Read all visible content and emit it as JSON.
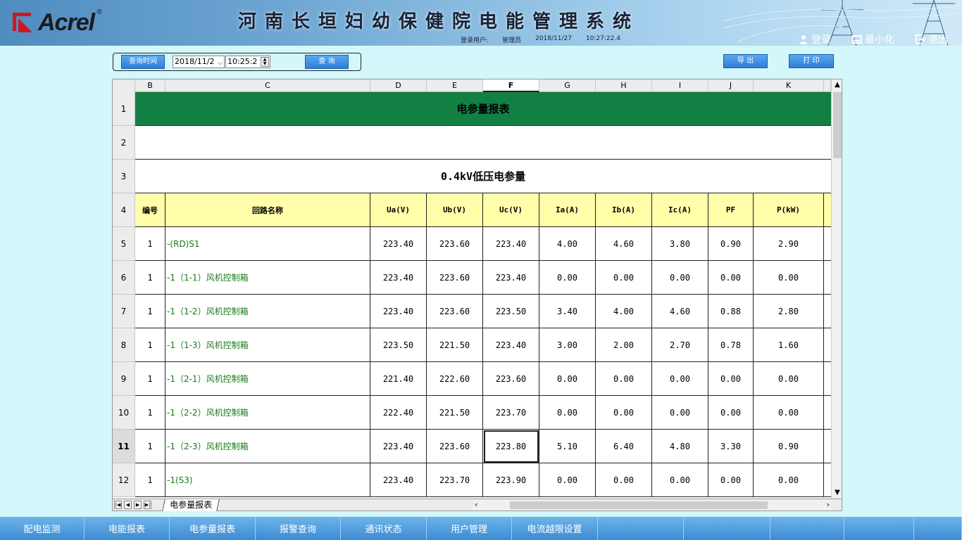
{
  "header": {
    "logo_text": "Acrel",
    "logo_reg": "®",
    "title": "河南长垣妇幼保健院电能管理系统",
    "login_label": "登录用户:",
    "login_user": "管理员",
    "login_date": "2018/11/27",
    "login_time": "10:27:22.4",
    "actions": {
      "login": "登录",
      "minimize": "最小化",
      "logout": "退出"
    }
  },
  "query": {
    "time_label": "查询时间",
    "date_value": "2018/11/2",
    "time_value": "10:25:2",
    "query_btn": "查 询",
    "export_btn": "导 出",
    "print_btn": "打 印"
  },
  "sheet": {
    "columns": [
      "B",
      "C",
      "D",
      "E",
      "F",
      "G",
      "H",
      "I",
      "J",
      "K"
    ],
    "active_column": "F",
    "row_numbers": [
      "1",
      "2",
      "3",
      "4",
      "5",
      "6",
      "7",
      "8",
      "9",
      "10",
      "11",
      "12"
    ],
    "active_row": "11",
    "title": "电参量报表",
    "section": "0.4kV低压电参量",
    "headers": [
      "编号",
      "回路名称",
      "Ua(V)",
      "Ub(V)",
      "Uc(V)",
      "Ia(A)",
      "Ib(A)",
      "Ic(A)",
      "PF",
      "P(kW)"
    ],
    "rows": [
      [
        "1",
        "-(RD)S1",
        "223.40",
        "223.60",
        "223.40",
        "4.00",
        "4.60",
        "3.80",
        "0.90",
        "2.90"
      ],
      [
        "1",
        "-1（1-1）风机控制箱",
        "223.40",
        "223.60",
        "223.40",
        "0.00",
        "0.00",
        "0.00",
        "0.00",
        "0.00"
      ],
      [
        "1",
        "-1（1-2）风机控制箱",
        "223.40",
        "223.60",
        "223.50",
        "3.40",
        "4.00",
        "4.60",
        "0.88",
        "2.80"
      ],
      [
        "1",
        "-1（1-3）风机控制箱",
        "223.50",
        "221.50",
        "223.40",
        "3.00",
        "2.00",
        "2.70",
        "0.78",
        "1.60"
      ],
      [
        "1",
        "-1（2-1）风机控制箱",
        "221.40",
        "222.60",
        "223.60",
        "0.00",
        "0.00",
        "0.00",
        "0.00",
        "0.00"
      ],
      [
        "1",
        "-1（2-2）风机控制箱",
        "222.40",
        "221.50",
        "223.70",
        "0.00",
        "0.00",
        "0.00",
        "0.00",
        "0.00"
      ],
      [
        "1",
        "-1（2-3）风机控制箱",
        "223.40",
        "223.60",
        "223.80",
        "5.10",
        "6.40",
        "4.80",
        "3.30",
        "0.90"
      ],
      [
        "1",
        "-1(S3)",
        "223.40",
        "223.70",
        "223.90",
        "0.00",
        "0.00",
        "0.00",
        "0.00",
        "0.00"
      ]
    ],
    "tab_name": "电参量报表"
  },
  "bottom_nav": [
    "配电监测",
    "电能报表",
    "电参量报表",
    "报警查询",
    "通讯状态",
    "用户管理",
    "电流越限设置",
    "",
    "",
    "",
    "",
    ""
  ],
  "colors": {
    "title_green": "#128043",
    "header_yellow": "#ffffaa",
    "name_green": "#1a7a1a",
    "nav_blue": "#3c8ad3"
  }
}
